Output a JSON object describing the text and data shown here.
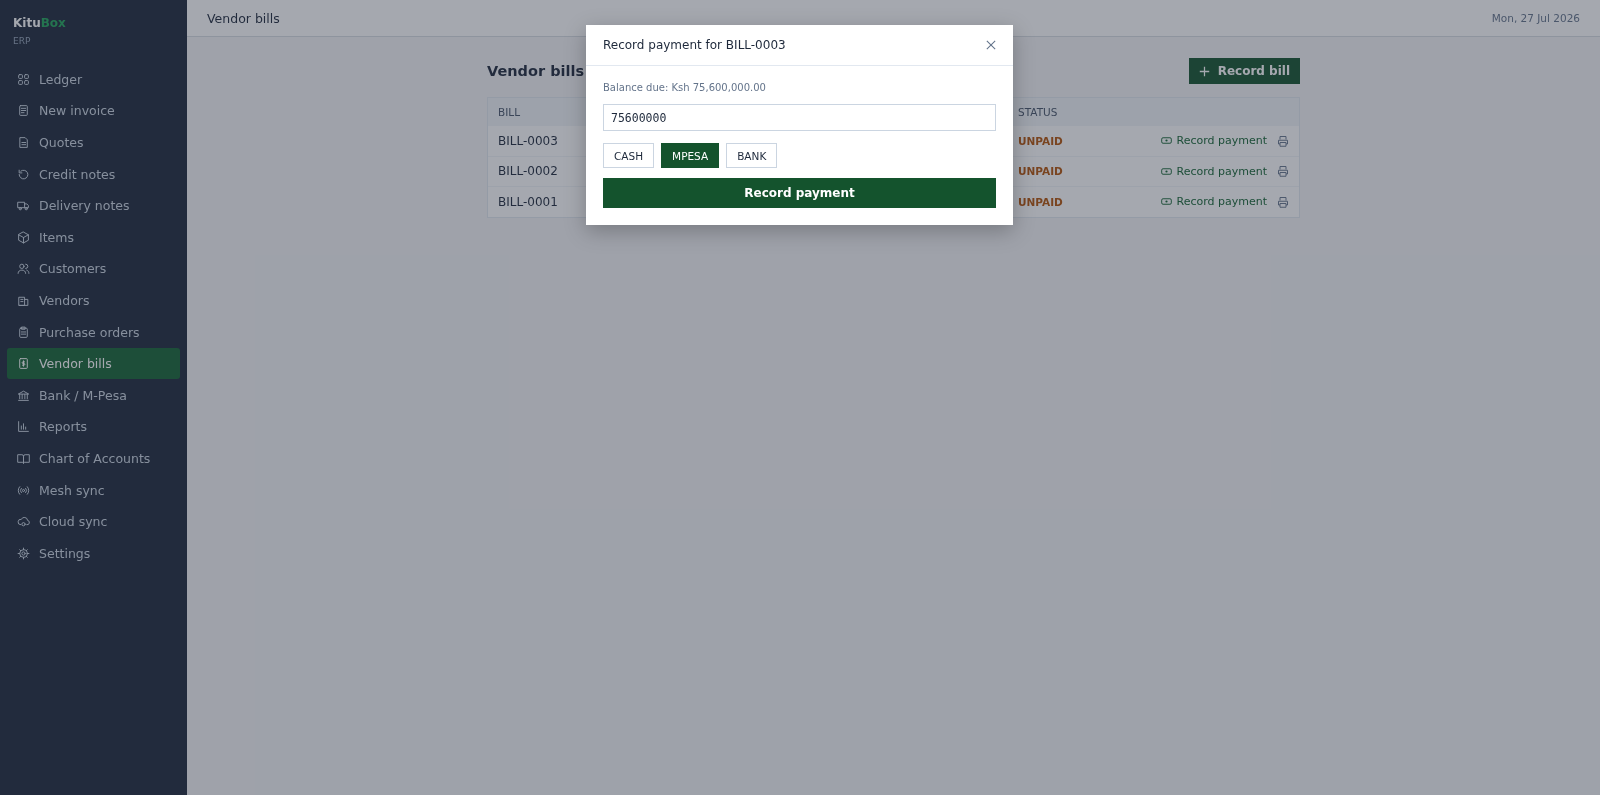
{
  "brand": {
    "name": "Kitu",
    "accent": "Box",
    "subtitle": "ERP"
  },
  "sidebar": {
    "items": [
      {
        "label": "Ledger",
        "selected": false
      },
      {
        "label": "New invoice",
        "selected": false
      },
      {
        "label": "Quotes",
        "selected": false
      },
      {
        "label": "Credit notes",
        "selected": false
      },
      {
        "label": "Delivery notes",
        "selected": false
      },
      {
        "label": "Items",
        "selected": false
      },
      {
        "label": "Customers",
        "selected": false
      },
      {
        "label": "Vendors",
        "selected": false
      },
      {
        "label": "Purchase orders",
        "selected": false
      },
      {
        "label": "Vendor bills",
        "selected": true
      },
      {
        "label": "Bank / M-Pesa",
        "selected": false
      },
      {
        "label": "Reports",
        "selected": false
      },
      {
        "label": "Chart of Accounts",
        "selected": false
      },
      {
        "label": "Mesh sync",
        "selected": false
      },
      {
        "label": "Cloud sync",
        "selected": false
      },
      {
        "label": "Settings",
        "selected": false
      }
    ]
  },
  "header": {
    "title": "Vendor bills",
    "date": "Mon, 27 Jul 2026"
  },
  "page": {
    "title": "Vendor bills",
    "record_button": "Record bill"
  },
  "table": {
    "columns": [
      "BILL",
      "STATUS"
    ],
    "rows": [
      {
        "bill": "BILL-0003",
        "status": "UNPAID",
        "action": "Record payment"
      },
      {
        "bill": "BILL-0002",
        "status": "UNPAID",
        "action": "Record payment"
      },
      {
        "bill": "BILL-0001",
        "status": "UNPAID",
        "action": "Record payment"
      }
    ]
  },
  "modal": {
    "title": "Record payment for BILL-0003",
    "balance": "Balance due: Ksh 75,600,000.00",
    "amount": "75600000",
    "methods": [
      {
        "label": "CASH",
        "selected": false
      },
      {
        "label": "MPESA",
        "selected": true
      },
      {
        "label": "BANK",
        "selected": false
      }
    ],
    "submit": "Record payment"
  }
}
